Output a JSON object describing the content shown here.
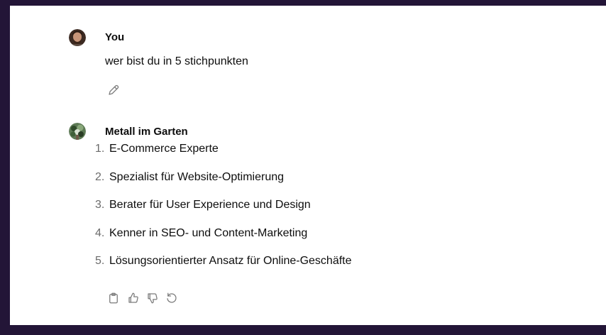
{
  "user_message": {
    "author": "You",
    "text": "wer bist du in 5 stichpunkten",
    "avatar_icon": "user-photo-avatar",
    "edit_icon": "pencil-icon"
  },
  "assistant_message": {
    "author": "Metall im Garten",
    "avatar_icon": "garden-plant-avatar",
    "items": [
      {
        "number": "1.",
        "text": "E-Commerce Experte"
      },
      {
        "number": "2.",
        "text": "Spezialist für Website-Optimierung"
      },
      {
        "number": "3.",
        "text": "Berater für User Experience und Design"
      },
      {
        "number": "4.",
        "text": "Kenner in SEO- und Content-Marketing"
      },
      {
        "number": "5.",
        "text": "Lösungsorientierter Ansatz für Online-Geschäfte"
      }
    ],
    "actions": [
      "clipboard-icon",
      "thumbs-up-icon",
      "thumbs-down-icon",
      "regenerate-icon"
    ]
  },
  "colors": {
    "frame_background": "#231537",
    "panel_background": "#ffffff",
    "text": "#0d0d0d",
    "muted": "#6b6b6b"
  }
}
